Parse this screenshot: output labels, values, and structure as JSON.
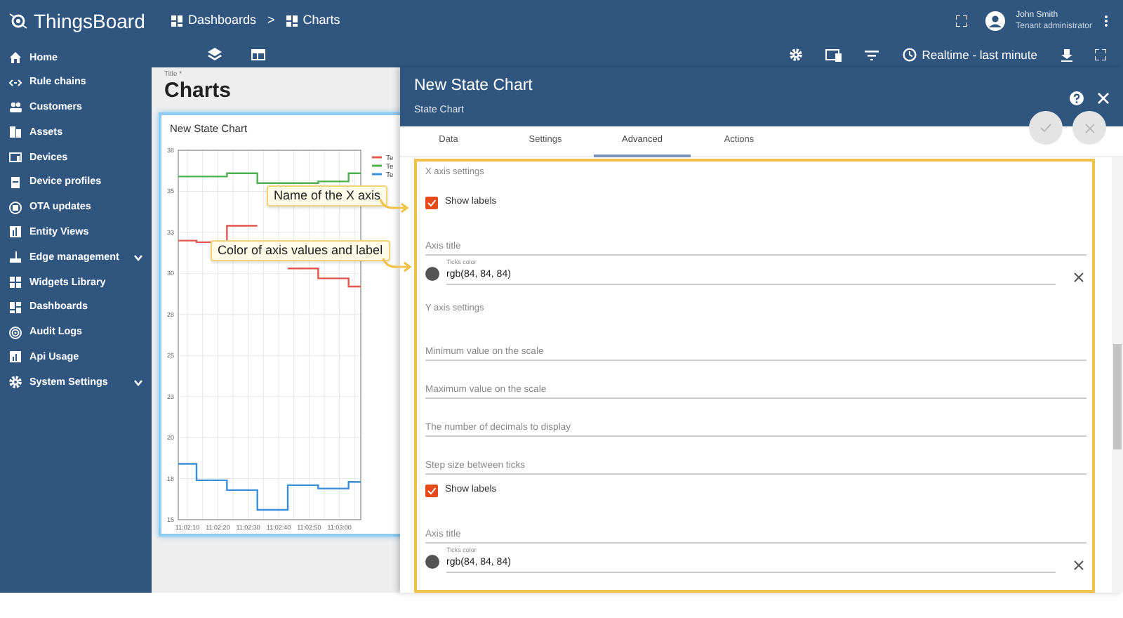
{
  "app": {
    "name": "ThingsBoard"
  },
  "breadcrumb": [
    {
      "label": "Dashboards"
    },
    {
      "label": "Charts"
    }
  ],
  "breadcrumb_separator": ">",
  "user": {
    "name": "John Smith",
    "role": "Tenant administrator"
  },
  "sidebar": {
    "items": [
      {
        "label": "Home",
        "expandable": false
      },
      {
        "label": "Rule chains",
        "expandable": false
      },
      {
        "label": "Customers",
        "expandable": false
      },
      {
        "label": "Assets",
        "expandable": false
      },
      {
        "label": "Devices",
        "expandable": false
      },
      {
        "label": "Device profiles",
        "expandable": false
      },
      {
        "label": "OTA updates",
        "expandable": false
      },
      {
        "label": "Entity Views",
        "expandable": false
      },
      {
        "label": "Edge management",
        "expandable": true
      },
      {
        "label": "Widgets Library",
        "expandable": false
      },
      {
        "label": "Dashboards",
        "expandable": false
      },
      {
        "label": "Audit Logs",
        "expandable": false
      },
      {
        "label": "Api Usage",
        "expandable": false
      },
      {
        "label": "System Settings",
        "expandable": true
      }
    ]
  },
  "toolbar": {
    "timewindow": "Realtime - last minute"
  },
  "dashboard": {
    "title_label": "Title *",
    "title": "Charts",
    "widget": {
      "title": "New State Chart",
      "chart_data": {
        "type": "line",
        "grid": true,
        "x": [
          39727,
          39733,
          39733,
          39743,
          39743,
          39753,
          39753,
          39763,
          39763,
          39773,
          39773,
          39783,
          39783,
          39787
        ],
        "xlim": [
          39727,
          39787
        ],
        "xticks": [
          {
            "value": 39730,
            "label": "11:02:10"
          },
          {
            "value": 39740,
            "label": "11:02:20"
          },
          {
            "value": 39750,
            "label": "11:02:30"
          },
          {
            "value": 39760,
            "label": "11:02:40"
          },
          {
            "value": 39770,
            "label": "11:02:50"
          },
          {
            "value": 39780,
            "label": "11:03:00"
          }
        ],
        "yticks": [
          {
            "value": 15,
            "label": "15"
          },
          {
            "value": 17.5,
            "label": "18"
          },
          {
            "value": 20,
            "label": "20"
          },
          {
            "value": 22.5,
            "label": "23"
          },
          {
            "value": 25,
            "label": "25"
          },
          {
            "value": 27.5,
            "label": "28"
          },
          {
            "value": 30,
            "label": "30"
          },
          {
            "value": 32.5,
            "label": "33"
          },
          {
            "value": 35,
            "label": "35"
          },
          {
            "value": 37.5,
            "label": "38"
          }
        ],
        "ylim": [
          15,
          37.5
        ],
        "series": [
          {
            "name": "Te",
            "color": "#e0584f",
            "values": [
              32,
              32,
              31.9,
              31.9,
              32.9,
              32.9,
              null,
              null,
              30.3,
              30.3,
              29.7,
              29.7,
              29.2,
              29.2
            ]
          },
          {
            "name": "Te",
            "color": "#4caf50",
            "values": [
              35.9,
              35.9,
              35.9,
              35.9,
              36.1,
              36.1,
              35.5,
              35.5,
              35.5,
              35.5,
              35.6,
              35.6,
              36.1,
              36.1
            ]
          },
          {
            "name": "Te",
            "color": "#3b8fd9",
            "values": [
              18.4,
              18.4,
              17.4,
              17.4,
              16.8,
              16.8,
              15.6,
              15.6,
              17.1,
              17.1,
              16.9,
              16.9,
              17.3,
              17.3
            ]
          }
        ]
      }
    }
  },
  "callouts": [
    {
      "text": "Name of the X axis"
    },
    {
      "text": "Color of axis values and label"
    }
  ],
  "panel": {
    "title": "New State Chart",
    "subtitle": "State Chart",
    "tabs": [
      {
        "label": "Data",
        "selected": false
      },
      {
        "label": "Settings",
        "selected": false
      },
      {
        "label": "Advanced",
        "selected": true
      },
      {
        "label": "Actions",
        "selected": false
      }
    ],
    "fields": [
      {
        "kind": "heading",
        "text": "X axis settings"
      },
      {
        "kind": "checkbox",
        "label": "Show labels",
        "checked": true
      },
      {
        "kind": "input",
        "placeholder": "Axis title"
      },
      {
        "kind": "color",
        "label": "Ticks color",
        "value": "rgb(84, 84, 84)"
      },
      {
        "kind": "heading",
        "text": "Y axis settings"
      },
      {
        "kind": "input",
        "placeholder": "Minimum value on the scale"
      },
      {
        "kind": "input",
        "placeholder": "Maximum value on the scale"
      },
      {
        "kind": "input",
        "placeholder": "The number of decimals to display"
      },
      {
        "kind": "input",
        "placeholder": "Step size between ticks"
      },
      {
        "kind": "checkbox",
        "label": "Show labels",
        "checked": true
      },
      {
        "kind": "input",
        "placeholder": "Axis title"
      },
      {
        "kind": "color",
        "label": "Ticks color",
        "value": "rgb(84, 84, 84)"
      }
    ]
  }
}
